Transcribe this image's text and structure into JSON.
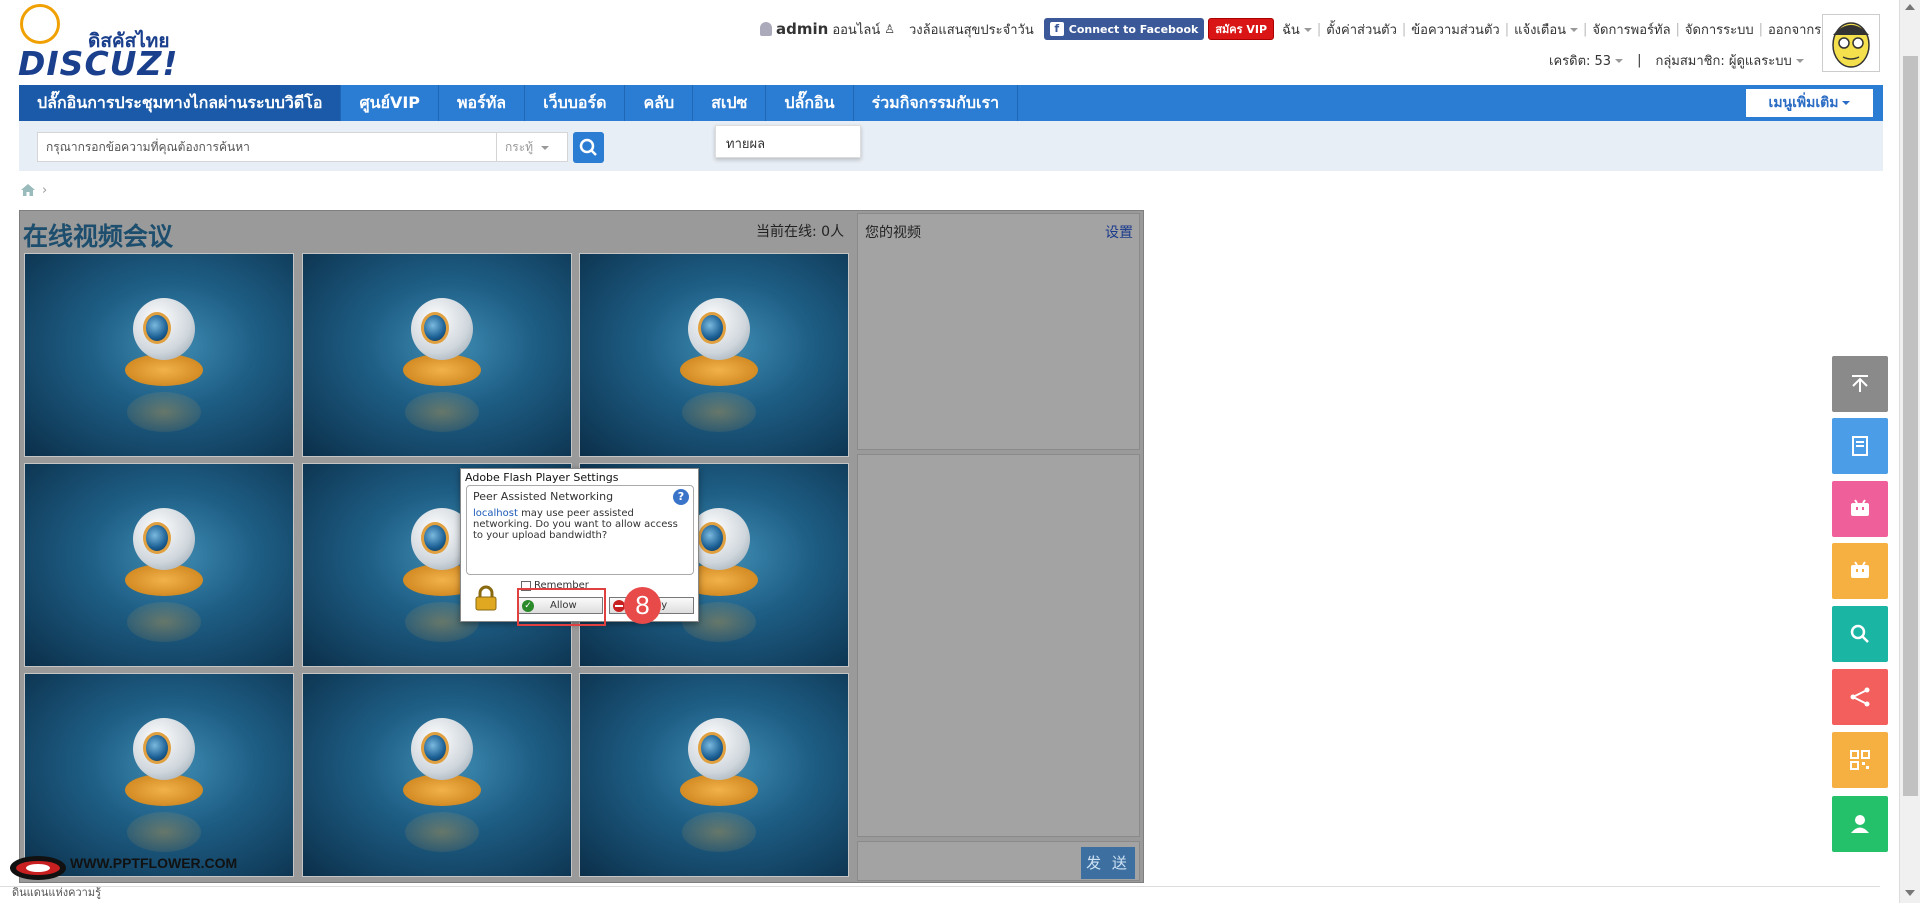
{
  "header": {
    "logo_thai": "ดิสคัสไทย",
    "logo_text": "DISCUZ!",
    "username": "admin",
    "online_status": "ออนไลน์",
    "daily_link": "วงล้อแสนสุขประจำวัน",
    "facebook_button": "Connect to Facebook",
    "vip_button": "สมัคร VIP",
    "menu_me": "ฉัน",
    "menu_settings": "ตั้งค่าส่วนตัว",
    "menu_messages": "ข้อความส่วนตัว",
    "menu_alerts": "แจ้งเตือน",
    "menu_portal": "จัดการพอร์ทัล",
    "menu_system": "จัดการระบบ",
    "menu_logout": "ออกจากระบบ",
    "credits": "เครดิต: 53",
    "usergroup": "กลุ่มสมาชิก: ผู้ดูแลระบบ"
  },
  "nav": {
    "items": [
      {
        "label": "ปลั๊กอินการประชุมทางไกลผ่านระบบวิดีโอ",
        "active": true
      },
      {
        "label": "ศูนย์VIP"
      },
      {
        "label": "พอร์ทัล"
      },
      {
        "label": "เว็บบอร์ด"
      },
      {
        "label": "คลับ"
      },
      {
        "label": "สเปซ"
      },
      {
        "label": "ปลั๊กอิน"
      },
      {
        "label": "ร่วมกิจกรรมกับเรา"
      }
    ],
    "more_menu": "เมนูเพิ่มเติม",
    "dropdown_item": "ทายผล"
  },
  "search": {
    "placeholder": "กรุณากรอกข้อความที่คุณต้องการค้นหา",
    "type_select": "กระทู้"
  },
  "conference": {
    "title": "在线视频会议",
    "online_count": "当前在线: 0人",
    "your_video": "您的视频",
    "settings": "设置",
    "send_button": "发 送"
  },
  "flash_dialog": {
    "title": "Adobe Flash Player Settings",
    "heading": "Peer Assisted Networking",
    "host": "localhost",
    "message": " may use peer assisted networking. Do you want to allow access to your upload bandwidth?",
    "remember": "Remember",
    "allow": "Allow",
    "deny": "Deny"
  },
  "step_badge": "8",
  "watermark": {
    "text": "WWW.PPTFLOWER.COM",
    "sub": "ดินแดนแห่งความรู้"
  },
  "colors": {
    "nav_bg": "#2b7cd3",
    "accent_red": "#e84a4a"
  },
  "floating_buttons": [
    {
      "icon": "back-to-top-icon",
      "color": "#8a8a8a"
    },
    {
      "icon": "document-icon",
      "color": "#4a9de6"
    },
    {
      "icon": "chat-pink-icon",
      "color": "#ef5f9a"
    },
    {
      "icon": "chat-orange-icon",
      "color": "#f5b041"
    },
    {
      "icon": "search-icon",
      "color": "#1ab5a3"
    },
    {
      "icon": "share-icon",
      "color": "#f25f5c"
    },
    {
      "icon": "qrcode-icon",
      "color": "#f5b041"
    },
    {
      "icon": "user-icon",
      "color": "#24c06a"
    }
  ]
}
